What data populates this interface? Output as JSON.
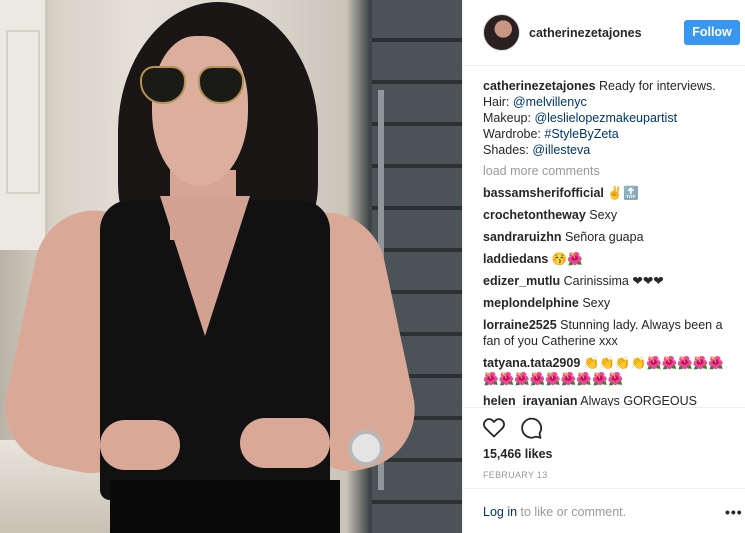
{
  "header": {
    "username": "catherinezetajones",
    "follow_label": "Follow"
  },
  "caption": {
    "username": "catherinezetajones",
    "text": "Ready for interviews.",
    "hair_label": "Hair:",
    "hair_handle": "@melvillenyc",
    "makeup_label": "Makeup:",
    "makeup_handle": "@leslielopezmakeupartist",
    "wardrobe_label": "Wardrobe:",
    "wardrobe_tag": "#StyleByZeta",
    "shades_label": "Shades:",
    "shades_handle": "@illesteva"
  },
  "load_more": "load more comments",
  "comments": [
    {
      "user": "bassamsherifofficial",
      "text": "✌️🔝"
    },
    {
      "user": "crochetontheway",
      "text": "Sexy"
    },
    {
      "user": "sandraruizhn",
      "text": "Señora guapa"
    },
    {
      "user": "laddiedans",
      "text": "😚🌺"
    },
    {
      "user": "edizer_mutlu",
      "text": "Carinissima ❤❤❤"
    },
    {
      "user": "meplondelphine",
      "text": "Sexy"
    },
    {
      "user": "lorraine2525",
      "text": "Stunning lady. Always been a fan of you Catherine xxx"
    },
    {
      "user": "tatyana.tata2909",
      "text": "👏👏👏👏🌺🌺🌺🌺🌺🌺🌺🌺🌺🌺🌺🌺🌺🌺"
    },
    {
      "user": "helen_irayanian",
      "text": "Always GORGEOUS"
    }
  ],
  "likes": "15,466 likes",
  "date": "FEBRUARY 13",
  "footer": {
    "login_link": "Log in",
    "login_rest": " to like or comment.",
    "more": "•••"
  },
  "colors": {
    "follow_bg": "#3897f0",
    "link": "#003569",
    "muted": "#999999"
  },
  "icons": {
    "like": "heart-icon",
    "comment": "comment-icon",
    "more": "more-options-icon"
  }
}
